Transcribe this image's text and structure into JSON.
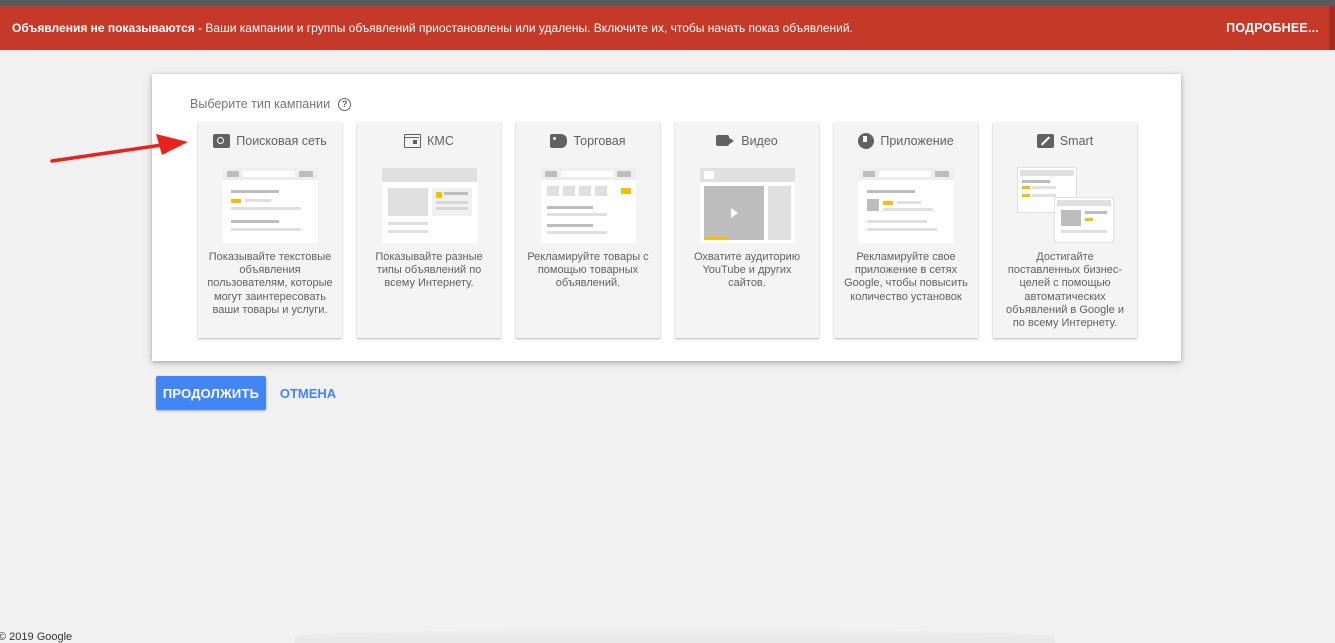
{
  "banner": {
    "title": "Объявления не показываются",
    "message": " - Ваши кампании и группы объявлений приостановлены или удалены. Включите их, чтобы начать показ объявлений.",
    "more_link": "ПОДРОБНЕЕ..."
  },
  "panel": {
    "title": "Выберите тип кампании",
    "help_icon": "help-circle-icon"
  },
  "cards": [
    {
      "label": "Поисковая сеть",
      "icon": "search-icon",
      "description": "Показывайте текстовые объявления пользователям, которые могут заинтересовать ваши товары и услуги."
    },
    {
      "label": "КМС",
      "icon": "display-icon",
      "description": "Показывайте разные типы объявлений по всему Интернету."
    },
    {
      "label": "Торговая",
      "icon": "tag-icon",
      "description": "Рекламируйте товары с помощью товарных объявлений."
    },
    {
      "label": "Видео",
      "icon": "video-icon",
      "description": "Охватите аудиторию YouTube и других сайтов."
    },
    {
      "label": "Приложение",
      "icon": "app-download-icon",
      "description": "Рекламируйте свое приложение в сетях Google, чтобы повысить количество установок"
    },
    {
      "label": "Smart",
      "icon": "magic-wand-icon",
      "description": "Достигайте поставленных бизнес-целей с помощью автоматических объявлений в Google и по всему Интернету."
    }
  ],
  "actions": {
    "continue": "ПРОДОЛЖИТЬ",
    "cancel": "ОТМЕНА"
  },
  "footer": {
    "copyright": "© 2019 Google"
  },
  "colors": {
    "banner": "#c53929",
    "primary": "#4285f4",
    "accent_yellow": "#fbbc04",
    "annotation_arrow": "#e8231c"
  }
}
